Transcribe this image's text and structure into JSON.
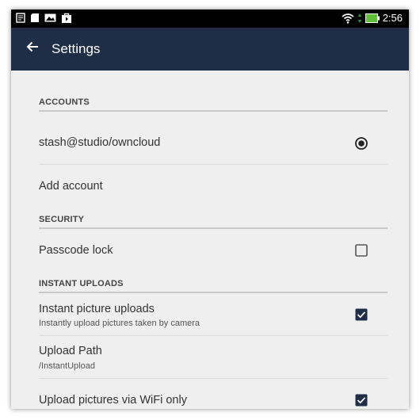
{
  "statusbar": {
    "time": "2:56",
    "icons": [
      "notes-icon",
      "sd-card-icon",
      "gallery-icon",
      "store-bag-icon"
    ],
    "right_icons": [
      "wifi-icon",
      "data-arrows-icon",
      "battery-icon"
    ]
  },
  "appbar": {
    "title": "Settings",
    "back_icon": "arrow-back-icon"
  },
  "sections": {
    "accounts": {
      "header": "ACCOUNTS",
      "account": {
        "label": "stash@studio/owncloud",
        "selected": true
      },
      "add_account": {
        "label": "Add account"
      }
    },
    "security": {
      "header": "SECURITY",
      "passcode": {
        "label": "Passcode lock",
        "checked": false
      }
    },
    "instant_uploads": {
      "header": "INSTANT UPLOADS",
      "instant_pictures": {
        "label": "Instant picture uploads",
        "summary": "Instantly upload pictures taken by camera",
        "checked": true
      },
      "upload_path": {
        "label": "Upload Path",
        "summary": "/InstantUpload"
      },
      "wifi_only": {
        "label": "Upload pictures via WiFi only",
        "checked": true
      }
    }
  },
  "colors": {
    "appbar": "#1f2d46",
    "background": "#efefef",
    "checkbox_fill": "#1f2d46"
  }
}
